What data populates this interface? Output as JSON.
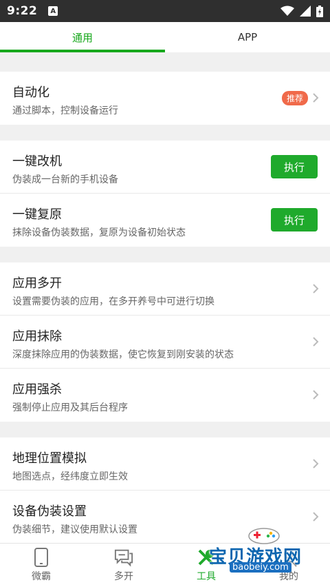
{
  "status": {
    "time": "9:22",
    "notif": "A"
  },
  "tabs": [
    {
      "label": "通用",
      "active": true
    },
    {
      "label": "APP",
      "active": false
    }
  ],
  "sections": {
    "automation": {
      "title": "自动化",
      "subtitle": "通过脚本，控制设备运行",
      "badge": "推荐"
    },
    "modify": {
      "title": "一键改机",
      "subtitle": "伪装成一台新的手机设备",
      "button": "执行"
    },
    "restore": {
      "title": "一键复原",
      "subtitle": "抹除设备伪装数据，复原为设备初始状态",
      "button": "执行"
    },
    "multi_open": {
      "title": "应用多开",
      "subtitle": "设置需要伪装的应用，在多开养号中可进行切换"
    },
    "app_wipe": {
      "title": "应用抹除",
      "subtitle": "深度抹除应用的伪装数据，使它恢复到刚安装的状态"
    },
    "force_kill": {
      "title": "应用强杀",
      "subtitle": "强制停止应用及其后台程序"
    },
    "geo": {
      "title": "地理位置模拟",
      "subtitle": "地图选点，经纬度立即生效"
    },
    "device_disguise": {
      "title": "设备伪装设置",
      "subtitle": "伪装细节，建议使用默认设置"
    }
  },
  "bottom_nav": [
    {
      "label": "微霸",
      "icon": "phone-icon",
      "active": false
    },
    {
      "label": "多开",
      "icon": "chat-icon",
      "active": false
    },
    {
      "label": "工具",
      "icon": "tools-icon",
      "active": true
    },
    {
      "label": "我的",
      "icon": "person-icon",
      "active": false
    }
  ],
  "watermark": {
    "title": "宝贝游戏网",
    "url": "baobeiy.com"
  },
  "colors": {
    "accent": "#18a81d",
    "badge": "#f06a4a",
    "status_bar": "#2f2f2f"
  }
}
